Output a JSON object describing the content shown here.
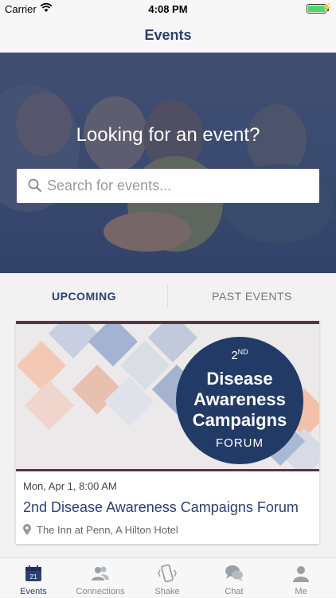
{
  "status_bar": {
    "carrier": "Carrier",
    "time": "4:08 PM"
  },
  "nav": {
    "title": "Events"
  },
  "hero": {
    "title": "Looking for an event?",
    "search_placeholder": "Search for events..."
  },
  "tabs": {
    "upcoming": "UPCOMING",
    "past": "PAST EVENTS"
  },
  "event": {
    "image": {
      "ordinal": "2",
      "ordinal_suffix": "ND",
      "line1": "Disease",
      "line2": "Awareness",
      "line3": "Campaigns",
      "forum": "FORUM"
    },
    "date": "Mon, Apr 1, 8:00 AM",
    "title": "2nd Disease Awareness Campaigns Forum",
    "location": "The Inn at Penn, A Hilton Hotel"
  },
  "tab_bar": {
    "items": [
      {
        "label": "Events",
        "icon": "calendar-icon",
        "badge": "21"
      },
      {
        "label": "Connections",
        "icon": "people-icon"
      },
      {
        "label": "Shake",
        "icon": "phone-shake-icon"
      },
      {
        "label": "Chat",
        "icon": "chat-bubbles-icon"
      },
      {
        "label": "Me",
        "icon": "person-icon"
      }
    ]
  },
  "colors": {
    "primary": "#2c4070",
    "accent_bar": "#5b3342",
    "battery": "#4cd964"
  }
}
